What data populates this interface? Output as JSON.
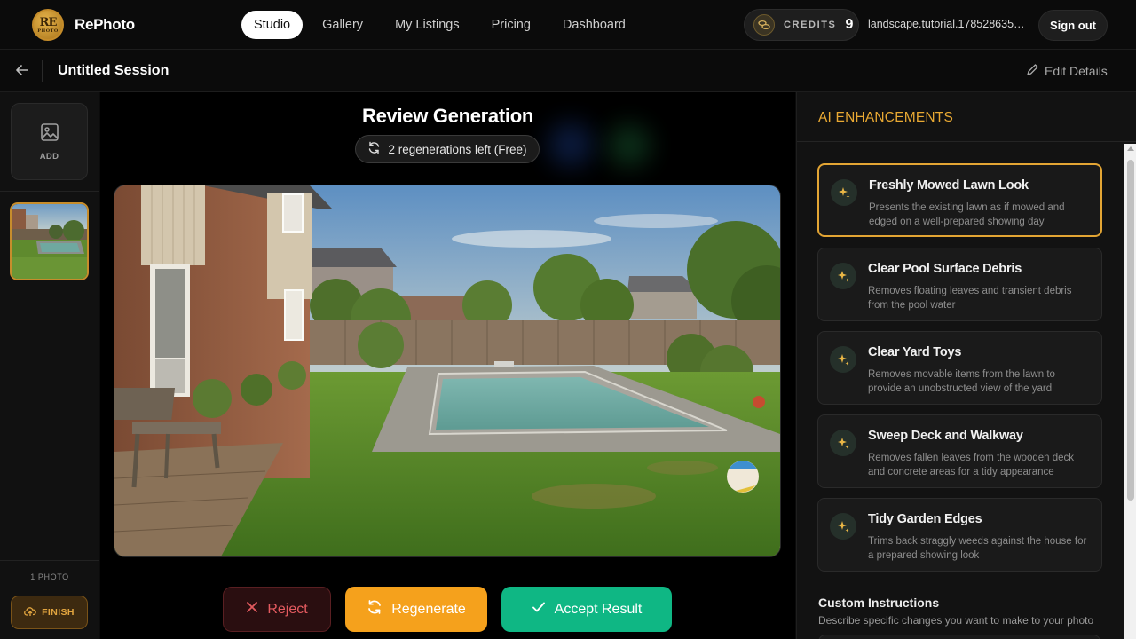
{
  "brand": {
    "logo_line1": "RE",
    "logo_line2": "PHOTO",
    "name": "RePhoto"
  },
  "nav": {
    "tabs": [
      {
        "label": "Studio",
        "active": true
      },
      {
        "label": "Gallery",
        "active": false
      },
      {
        "label": "My Listings",
        "active": false
      },
      {
        "label": "Pricing",
        "active": false
      },
      {
        "label": "Dashboard",
        "active": false
      }
    ],
    "credits_label": "CREDITS",
    "credits_value": "9",
    "email": "landscape.tutorial.1785286354...",
    "signout_label": "Sign out"
  },
  "session": {
    "title": "Untitled Session",
    "edit_label": "Edit Details"
  },
  "left_rail": {
    "add_label": "ADD",
    "photo_count": "1 PHOTO",
    "finish_label": "FINISH"
  },
  "review": {
    "title": "Review Generation",
    "regenerations": "2 regenerations left (Free)",
    "reject_label": "Reject",
    "regenerate_label": "Regenerate",
    "accept_label": "Accept Result"
  },
  "enhancements": {
    "title": "AI ENHANCEMENTS",
    "items": [
      {
        "title": "Freshly Mowed Lawn Look",
        "desc": "Presents the existing lawn as if mowed and edged on a well-prepared showing day",
        "selected": true
      },
      {
        "title": "Clear Pool Surface Debris",
        "desc": "Removes floating leaves and transient debris from the pool water",
        "selected": false
      },
      {
        "title": "Clear Yard Toys",
        "desc": "Removes movable items from the lawn to provide an unobstructed view of the yard",
        "selected": false
      },
      {
        "title": "Sweep Deck and Walkway",
        "desc": "Removes fallen leaves from the wooden deck and concrete areas for a tidy appearance",
        "selected": false
      },
      {
        "title": "Tidy Garden Edges",
        "desc": "Trims back straggly weeds against the house for a prepared showing look",
        "selected": false
      }
    ],
    "custom_title": "Custom Instructions",
    "custom_desc": "Describe specific changes you want to make to your photo"
  },
  "colors": {
    "accent_gold": "#e9a933",
    "reject_red": "#e35a5f",
    "regenerate_orange": "#f5a11c",
    "accept_green": "#0fb784"
  },
  "icons": {
    "back": "arrow-left-icon",
    "edit": "pencil-icon",
    "add": "image-icon",
    "finish": "cloud-upload-icon",
    "regen": "refresh-icon",
    "reject": "x-icon",
    "accept": "check-icon",
    "spark": "sparkle-icon",
    "coin": "coin-icon"
  }
}
